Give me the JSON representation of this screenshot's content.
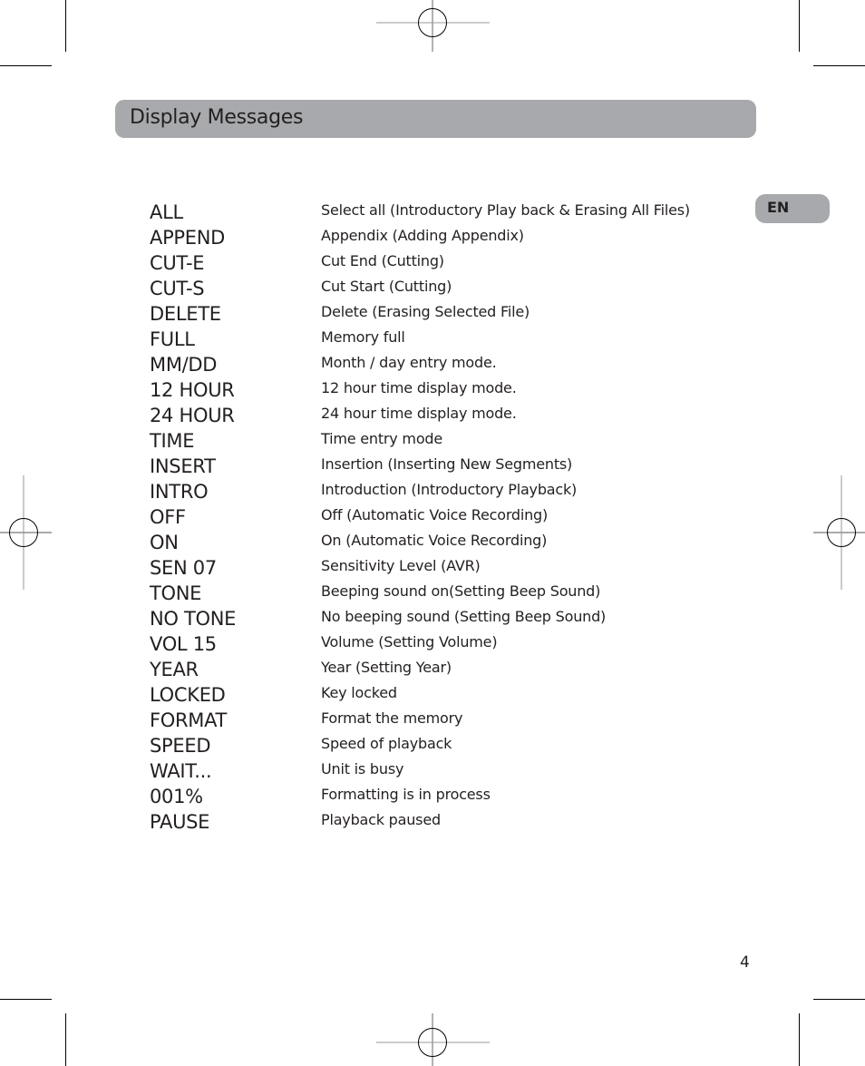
{
  "header": {
    "title": "Display Messages"
  },
  "language_tab": {
    "label": "EN"
  },
  "messages": [
    {
      "code": "ALL",
      "description": "Select all (Introductory Play back & Erasing All Files)"
    },
    {
      "code": "APPEND",
      "description": "Appendix (Adding Appendix)"
    },
    {
      "code": "CUT-E",
      "description": "Cut End (Cutting)"
    },
    {
      "code": "CUT-S",
      "description": "Cut Start (Cutting)"
    },
    {
      "code": "DELETE",
      "description": "Delete (Erasing Selected File)"
    },
    {
      "code": "FULL",
      "description": "Memory full"
    },
    {
      "code": "MM/DD",
      "description": "Month / day entry mode."
    },
    {
      "code": "12 HOUR",
      "description": "12 hour time display mode."
    },
    {
      "code": "24 HOUR",
      "description": "24 hour time display mode."
    },
    {
      "code": "TIME",
      "description": "Time entry mode"
    },
    {
      "code": "INSERT",
      "description": "Insertion (Inserting New Segments)"
    },
    {
      "code": "INTRO",
      "description": "Introduction (Introductory Playback)"
    },
    {
      "code": "OFF",
      "description": "Off (Automatic Voice Recording)"
    },
    {
      "code": "ON",
      "description": "On (Automatic Voice Recording)"
    },
    {
      "code": "SEN 07",
      "description": "Sensitivity Level (AVR)"
    },
    {
      "code": "TONE",
      "description": "Beeping sound on(Setting Beep Sound)"
    },
    {
      "code": "NO TONE",
      "description": "No beeping sound (Setting Beep Sound)"
    },
    {
      "code": "VOL 15",
      "description": "Volume (Setting Volume)"
    },
    {
      "code": "YEAR",
      "description": "Year (Setting Year)"
    },
    {
      "code": "LOCKED",
      "description": "Key locked"
    },
    {
      "code": "FORMAT",
      "description": "Format the memory"
    },
    {
      "code": "SPEED",
      "description": "Speed of playback"
    },
    {
      "code": "WAIT...",
      "description": "Unit is busy"
    },
    {
      "code": "001%",
      "description": "Formatting is in process"
    },
    {
      "code": "PAUSE",
      "description": "Playback paused"
    }
  ],
  "footer": {
    "page_number": "4"
  },
  "colors": {
    "header_bar": "#a7a9ac",
    "text": "#231f20"
  }
}
